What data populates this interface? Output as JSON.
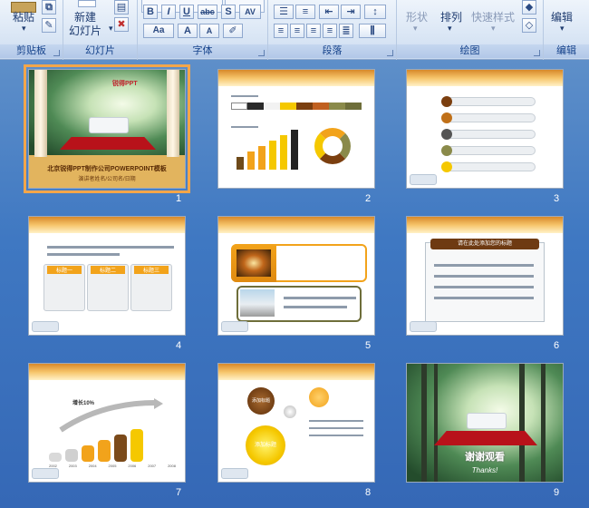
{
  "ribbon": {
    "clipboard": {
      "paste_label": "粘贴",
      "group_label": "剪贴板"
    },
    "slides": {
      "new_slide_label": "新建",
      "new_slide_label2": "幻灯片",
      "group_label": "幻灯片"
    },
    "font": {
      "group_label": "字体",
      "bold": "B",
      "italic": "I",
      "underline": "U",
      "strike": "abc",
      "shadow": "S",
      "spacing": "AV",
      "font_name": "",
      "font_size": "",
      "aa": "Aa",
      "grow": "A",
      "shrink": "A"
    },
    "paragraph": {
      "group_label": "段落"
    },
    "drawing": {
      "group_label": "绘图",
      "shape_label": "形状",
      "arrange_label": "排列",
      "quick_style_label": "快速样式"
    },
    "editing": {
      "group_label": "编辑",
      "edit_label": "编辑"
    }
  },
  "slides": [
    {
      "number": "1",
      "title": "北京锐得PPT制作公司POWERPOINT模板",
      "subtitle": "演讲者姓名/公司名/日期",
      "logo": "锐得PPT"
    },
    {
      "number": "2"
    },
    {
      "number": "3"
    },
    {
      "number": "4",
      "boxes": [
        "标题一",
        "标题二",
        "标题三"
      ]
    },
    {
      "number": "5"
    },
    {
      "number": "6",
      "header": "请在此处添加您的标题"
    },
    {
      "number": "7",
      "growth": "增长10%",
      "years": [
        "2002",
        "2003",
        "2004",
        "2005",
        "2006",
        "2007",
        "2008"
      ]
    },
    {
      "number": "8",
      "circle_top": "添加标题",
      "circle_mid": "添加标题"
    },
    {
      "number": "9",
      "thanks": "谢谢观看",
      "thanks_en": "Thanks!"
    }
  ],
  "colors": {
    "accent": "#f3a64a",
    "pane": "#3f78c2",
    "carpet": "#b8121a"
  }
}
